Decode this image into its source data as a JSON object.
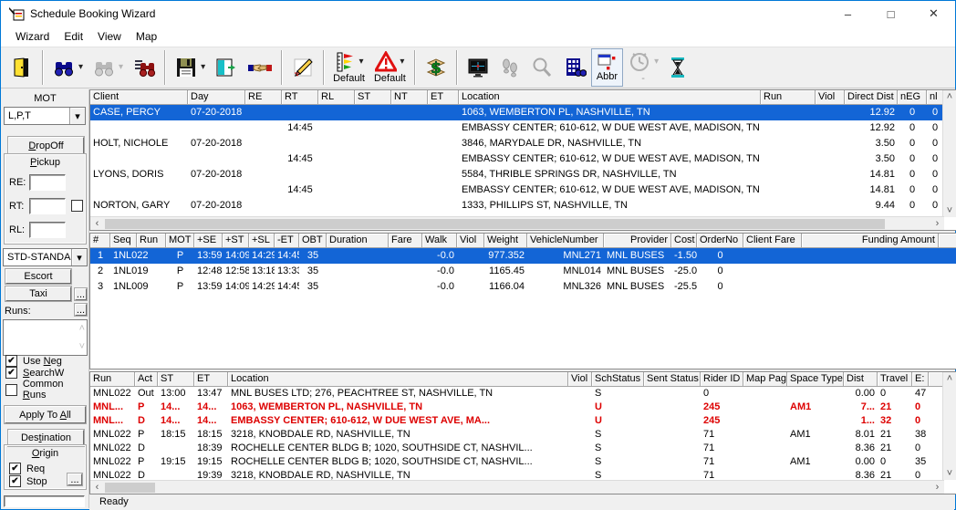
{
  "window": {
    "title": "Schedule Booking Wizard",
    "status": "Ready"
  },
  "menu": {
    "items": [
      "Wizard",
      "Edit",
      "View",
      "Map"
    ]
  },
  "toolbar": {
    "default_run_label": "Default",
    "default_violation_label": "Default",
    "abbr_label": "Abbr",
    "timer_label": "-"
  },
  "sidebar": {
    "mot_label": "MOT",
    "mot_value": "L,P,T",
    "dropoff_label": "DropOff",
    "pickup_label": "Pickup",
    "re_label": "RE:",
    "re_value": "",
    "rt_label": "RT:",
    "rt_value": "",
    "rt_checked": false,
    "rl_label": "RL:",
    "rl_value": "",
    "service_type_value": "STD-STANDA",
    "escort_label": "Escort",
    "taxi_label": "Taxi",
    "runs_label": "Runs:",
    "browse_label": "...",
    "use_neg": {
      "label": "Use Neg",
      "checked": true
    },
    "searchw": {
      "label": "SearchW",
      "checked": true
    },
    "common_runs": {
      "label": "Common Runs",
      "checked": false
    },
    "apply_to_all_label": "Apply To All",
    "destination_label": "Destination",
    "origin_label": "Origin",
    "req": {
      "label": "Req",
      "checked": true
    },
    "stop": {
      "label": "Stop",
      "checked": true
    }
  },
  "bookings_table": {
    "columns": [
      "Client",
      "Day",
      "RE",
      "RT",
      "RL",
      "ST",
      "NT",
      "ET",
      "Location",
      "Run",
      "Viol",
      "Direct Dist",
      "nEG",
      "nl"
    ],
    "selected_row": 0,
    "rows": [
      [
        "CASE, PERCY",
        "07-20-2018",
        "",
        "",
        "",
        "",
        "",
        "",
        "1063, WEMBERTON PL, NASHVILLE, TN",
        "",
        "",
        "12.92",
        "0",
        "0"
      ],
      [
        "",
        "",
        "",
        "14:45",
        "",
        "",
        "",
        "",
        "EMBASSY CENTER; 610-612, W DUE WEST AVE, MADISON, TN",
        "",
        "",
        "12.92",
        "0",
        "0"
      ],
      [
        "HOLT, NICHOLE",
        "07-20-2018",
        "",
        "",
        "",
        "",
        "",
        "",
        "3846, MARYDALE DR, NASHVILLE, TN",
        "",
        "",
        "3.50",
        "0",
        "0"
      ],
      [
        "",
        "",
        "",
        "14:45",
        "",
        "",
        "",
        "",
        "EMBASSY CENTER; 610-612, W DUE WEST AVE, MADISON, TN",
        "",
        "",
        "3.50",
        "0",
        "0"
      ],
      [
        "LYONS, DORIS",
        "07-20-2018",
        "",
        "",
        "",
        "",
        "",
        "",
        "5584, THRIBLE SPRINGS DR, NASHVILLE, TN",
        "",
        "",
        "14.81",
        "0",
        "0"
      ],
      [
        "",
        "",
        "",
        "14:45",
        "",
        "",
        "",
        "",
        "EMBASSY CENTER; 610-612, W DUE WEST AVE, MADISON, TN",
        "",
        "",
        "14.81",
        "0",
        "0"
      ],
      [
        "NORTON, GARY",
        "07-20-2018",
        "",
        "",
        "",
        "",
        "",
        "",
        "1333, PHILLIPS ST, NASHVILLE, TN",
        "",
        "",
        "9.44",
        "0",
        "0"
      ]
    ]
  },
  "solutions_table": {
    "columns": [
      "#",
      "Seq",
      "Run",
      "MOT",
      "+SE",
      "+ST",
      "+SL",
      "-ET",
      "OBT",
      "Duration",
      "Fare",
      "Walk",
      "Viol",
      "Weight",
      "VehicleNumber",
      "Provider",
      "Cost",
      "OrderNo",
      "Client Fare",
      "Funding Amount"
    ],
    "selected_row": 0,
    "rows": [
      [
        "1",
        "1NL022",
        "",
        "P",
        "13:59",
        "14:09",
        "14:29",
        "14:45",
        "35",
        "",
        "",
        "-0.0",
        "",
        "977.352",
        "MNL271",
        "MNL BUSES",
        "-1.50",
        "0",
        "",
        ""
      ],
      [
        "2",
        "1NL019",
        "",
        "P",
        "12:48",
        "12:58",
        "13:18",
        "13:33",
        "35",
        "",
        "",
        "-0.0",
        "",
        "1165.45",
        "MNL014",
        "MNL BUSES",
        "-25.00",
        "0",
        "",
        ""
      ],
      [
        "3",
        "1NL009",
        "",
        "P",
        "13:59",
        "14:09",
        "14:29",
        "14:45",
        "35",
        "",
        "",
        "-0.0",
        "",
        "1166.04",
        "MNL326",
        "MNL BUSES",
        "-25.50",
        "0",
        "",
        ""
      ]
    ]
  },
  "itinerary_table": {
    "columns": [
      "Run",
      "Act",
      "ST",
      "ET",
      "Location",
      "Viol",
      "SchStatus",
      "Sent Status",
      "Rider ID",
      "Map Page",
      "Space Type",
      "Dist",
      "Travel",
      "E:"
    ],
    "alert_rows": [
      1,
      2
    ],
    "rows": [
      [
        "MNL022",
        "Out",
        "13:00",
        "13:47",
        "MNL BUSES LTD; 276, PEACHTREE ST, NASHVILLE, TN",
        "",
        "S",
        "",
        "0",
        "",
        "",
        "0.00",
        "0",
        "47"
      ],
      [
        "MNL...",
        "P",
        "14...",
        "14...",
        "1063, WEMBERTON PL, NASHVILLE, TN",
        "",
        "U",
        "",
        "245",
        "",
        "AM1",
        "7...",
        "21",
        "0"
      ],
      [
        "MNL...",
        "D",
        "14...",
        "14...",
        "EMBASSY CENTER; 610-612, W DUE WEST AVE, MA...",
        "",
        "U",
        "",
        "245",
        "",
        "",
        "1...",
        "32",
        "0"
      ],
      [
        "MNL022",
        "P",
        "18:15",
        "18:15",
        "3218, KNOBDALE RD, NASHVILLE, TN",
        "",
        "S",
        "",
        "71",
        "",
        "AM1",
        "8.01",
        "21",
        "38"
      ],
      [
        "MNL022",
        "D",
        "",
        "18:39",
        "ROCHELLE CENTER BLDG B; 1020, SOUTHSIDE CT, NASHVIL...",
        "",
        "S",
        "",
        "71",
        "",
        "",
        "8.36",
        "21",
        "0"
      ],
      [
        "MNL022",
        "P",
        "19:15",
        "19:15",
        "ROCHELLE CENTER BLDG B; 1020, SOUTHSIDE CT, NASHVIL...",
        "",
        "S",
        "",
        "71",
        "",
        "AM1",
        "0.00",
        "0",
        "35"
      ],
      [
        "MNL022",
        "D",
        "",
        "19:39",
        "3218, KNOBDALE RD, NASHVILLE, TN",
        "",
        "S",
        "",
        "71",
        "",
        "",
        "8.36",
        "21",
        "0"
      ]
    ]
  },
  "icons": {
    "check": "✔",
    "dropdown": "▾",
    "scroll_up": "˄",
    "scroll_down": "˅",
    "scroll_left": "‹",
    "scroll_right": "›",
    "minimize": "–",
    "maximize": "□",
    "close": "✕"
  },
  "colors": {
    "selection_blue": "#1365D6",
    "alert_red": "#DD0000",
    "window_border": "#0078D7"
  }
}
